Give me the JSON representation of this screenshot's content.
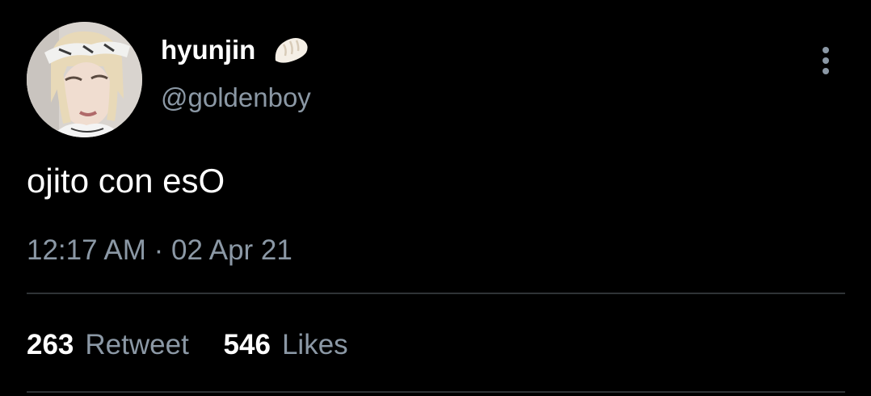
{
  "tweet": {
    "display_name": "hyunjin",
    "name_emoji": "dumpling-emoji",
    "handle": "@goldenboy",
    "text": "ojito con esO",
    "time": "12:17 AM",
    "separator": "·",
    "date": "02 Apr 21"
  },
  "stats": [
    {
      "count": "263",
      "label": "Retweet"
    },
    {
      "count": "546",
      "label": "Likes"
    }
  ],
  "icons": {
    "more": "more-vertical-icon"
  },
  "colors": {
    "background": "#000000",
    "primary_text": "#ffffff",
    "secondary_text": "#8b98a5",
    "divider": "#2f3336"
  }
}
